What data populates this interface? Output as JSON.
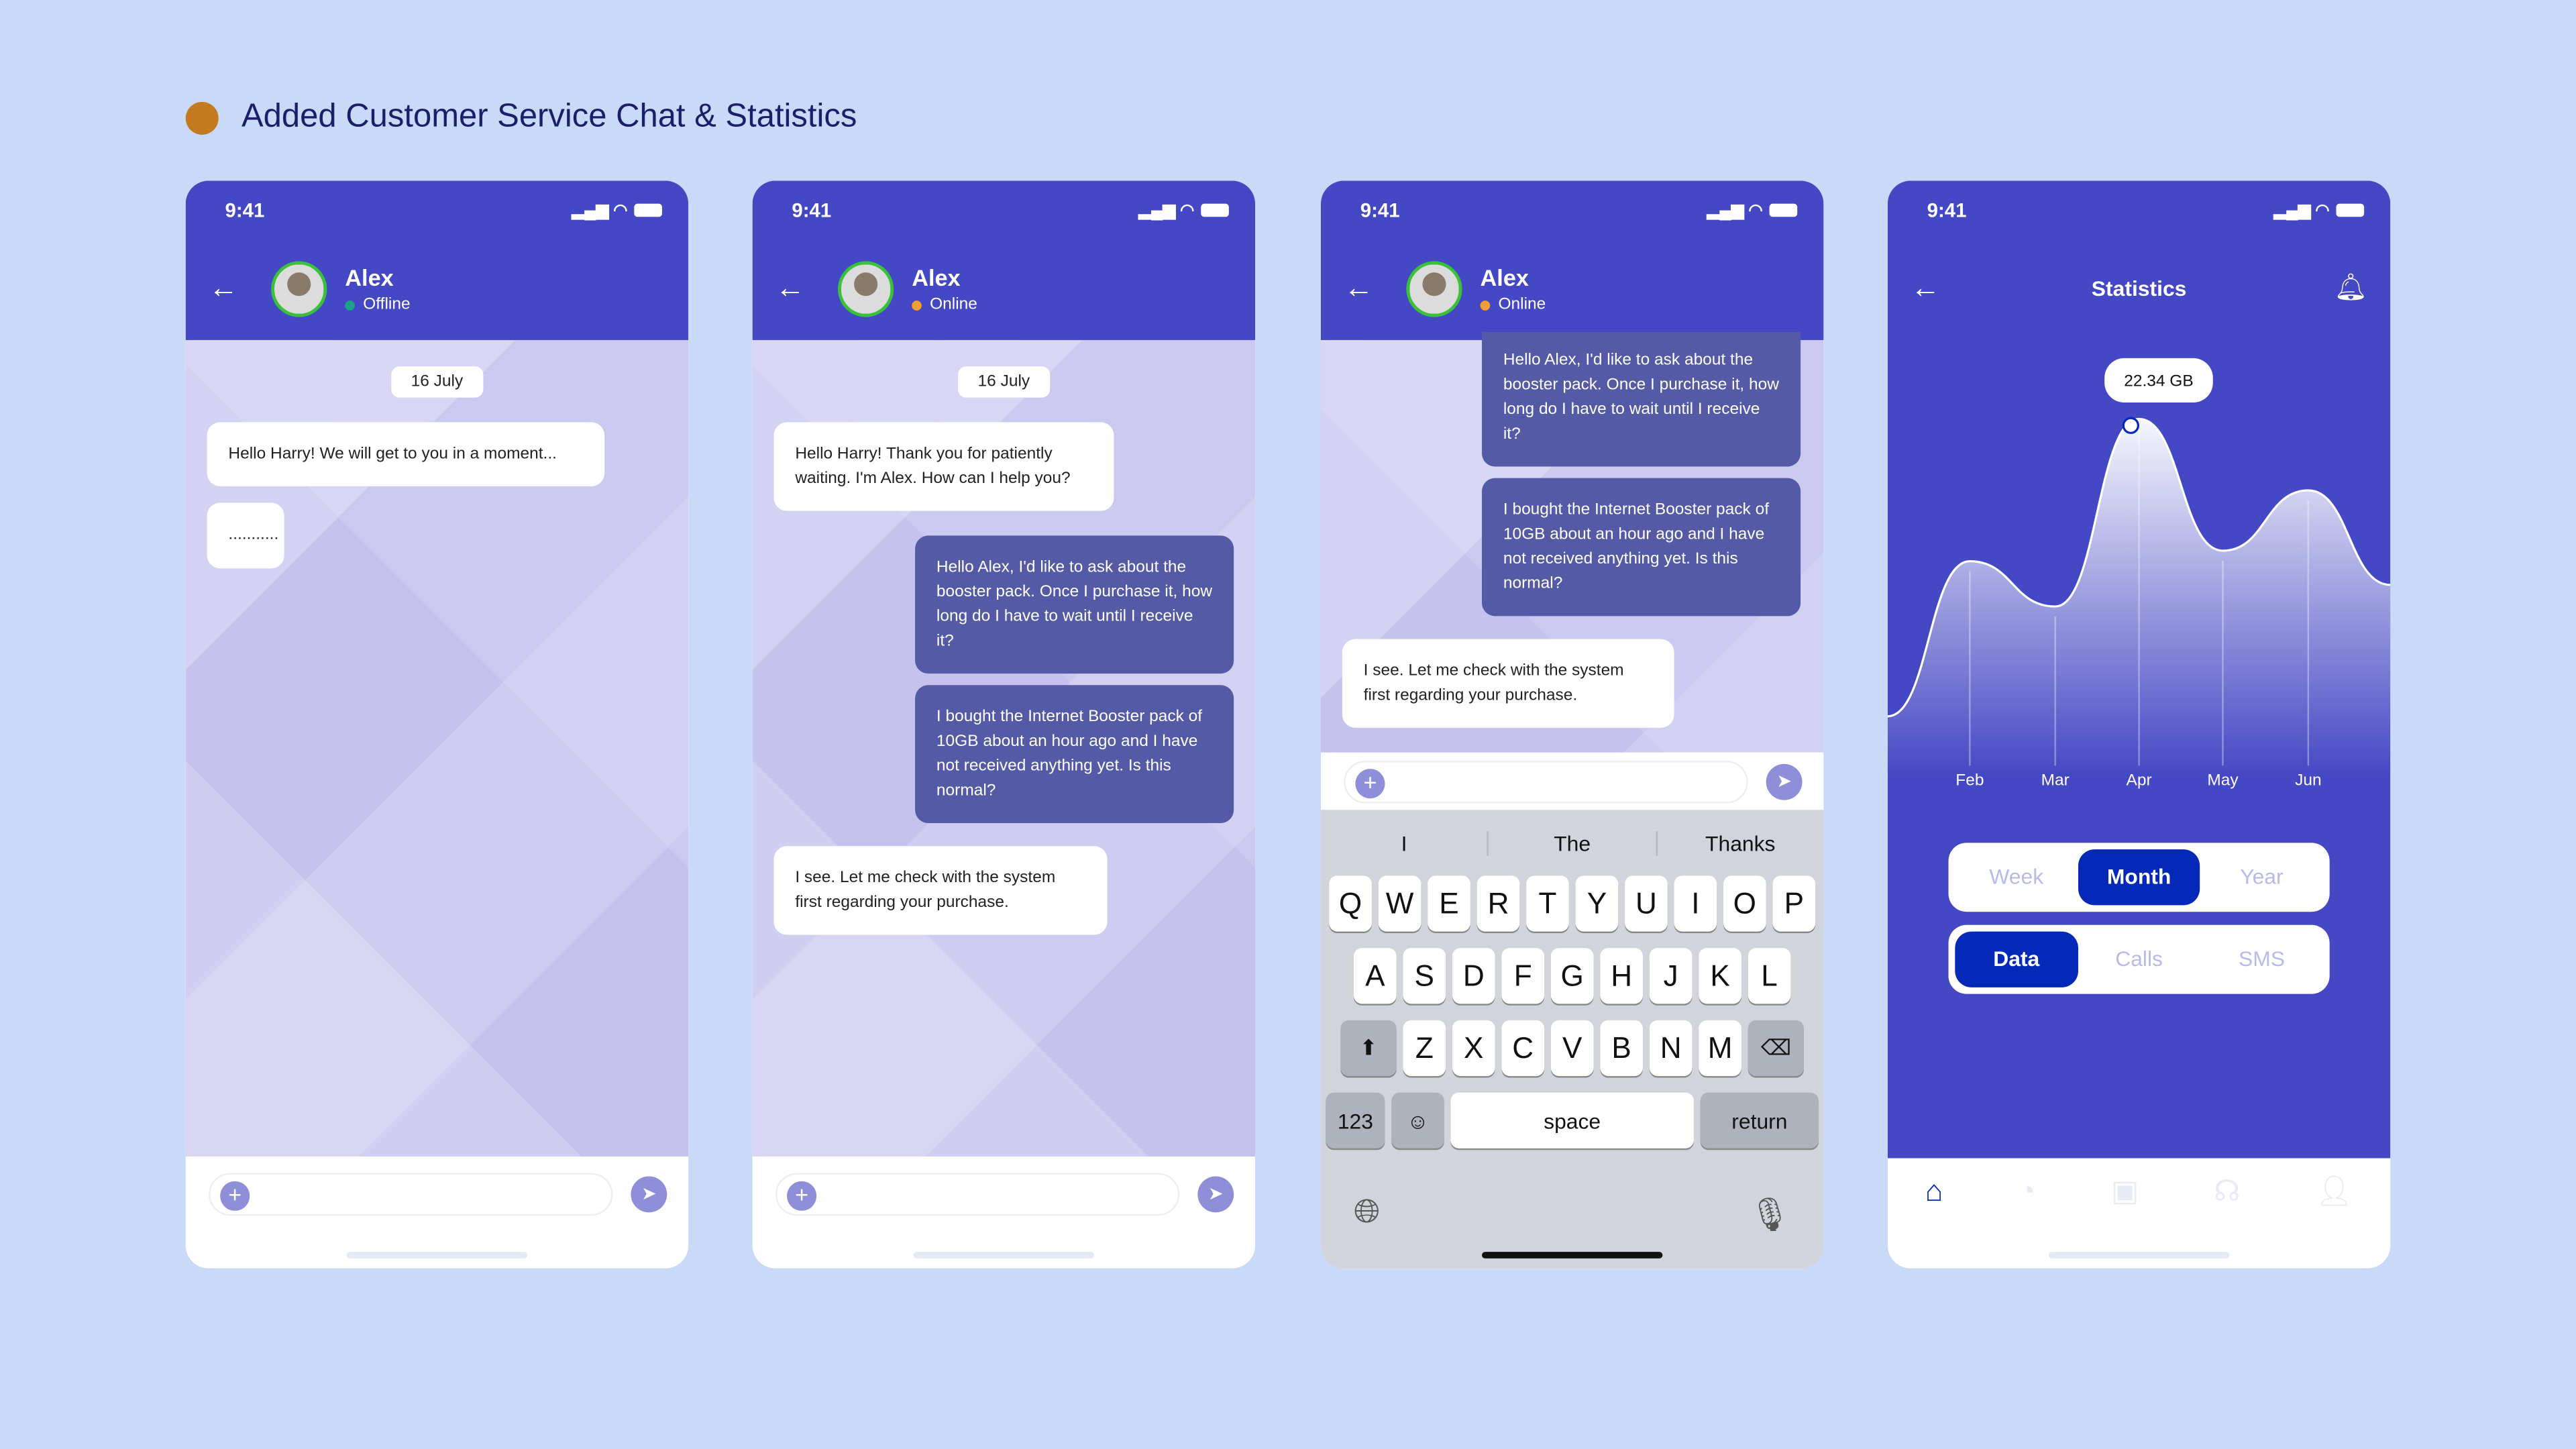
{
  "page_title": "Added Customer Service Chat & Statistics",
  "colors": {
    "brand": "#4548c4",
    "accent": "#0429b8",
    "title_dot": "#c47a1e",
    "online": "#f0a030",
    "offline": "#1aa38a"
  },
  "status_time": "9:41",
  "contact": {
    "name": "Alex",
    "offline": "Offline",
    "online": "Online"
  },
  "date_label": "16 July",
  "screen1": {
    "messages": [
      "Hello Harry! We will get to you in a moment...",
      "..........."
    ]
  },
  "screen2": {
    "messages": [
      "Hello Harry! Thank you for patiently waiting. I'm Alex. How can I help you?",
      "Hello Alex, I'd like to ask about the booster pack. Once I purchase it, how long do I have to wait until I receive it?",
      "I bought the Internet Booster pack of 10GB about an hour ago and I have not received anything yet. Is this normal?",
      "I see. Let me check with the system first regarding your purchase."
    ]
  },
  "keyboard": {
    "suggestions": [
      "I",
      "The",
      "Thanks"
    ],
    "row1": [
      "Q",
      "W",
      "E",
      "R",
      "T",
      "Y",
      "U",
      "I",
      "O",
      "P"
    ],
    "row2": [
      "A",
      "S",
      "D",
      "F",
      "G",
      "H",
      "J",
      "K",
      "L"
    ],
    "row3": [
      "Z",
      "X",
      "C",
      "V",
      "B",
      "N",
      "M"
    ],
    "num": "123",
    "space": "space",
    "return": "return"
  },
  "stats": {
    "title": "Statistics",
    "tooltip": "22.34 GB",
    "period_tabs": [
      "Week",
      "Month",
      "Year"
    ],
    "period_selected": "Month",
    "type_tabs": [
      "Data",
      "Calls",
      "SMS"
    ],
    "type_selected": "Data",
    "nav": [
      "home-icon",
      "pie-chart-icon",
      "shopping-bag-icon",
      "headset-icon",
      "user-icon"
    ]
  },
  "chart_data": {
    "type": "area",
    "categories": [
      "Feb",
      "Mar",
      "Apr",
      "May",
      "Jun"
    ],
    "values": [
      12.9,
      9.9,
      22.34,
      13.6,
      17.6
    ],
    "unit": "GB",
    "grid": false,
    "highlight": "Apr"
  }
}
